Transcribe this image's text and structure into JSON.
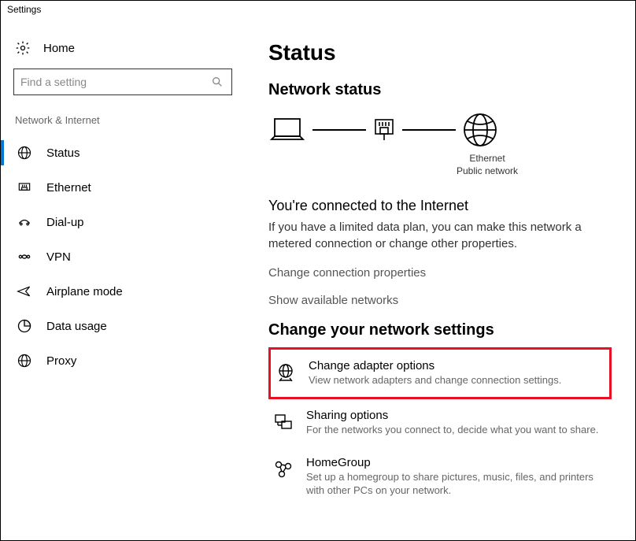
{
  "window_title": "Settings",
  "home_label": "Home",
  "search_placeholder": "Find a setting",
  "category_label": "Network & Internet",
  "nav": [
    {
      "label": "Status",
      "icon": "globe",
      "active": true
    },
    {
      "label": "Ethernet",
      "icon": "ethernet",
      "active": false
    },
    {
      "label": "Dial-up",
      "icon": "dialup",
      "active": false
    },
    {
      "label": "VPN",
      "icon": "vpn",
      "active": false
    },
    {
      "label": "Airplane mode",
      "icon": "airplane",
      "active": false
    },
    {
      "label": "Data usage",
      "icon": "datausage",
      "active": false
    },
    {
      "label": "Proxy",
      "icon": "proxy",
      "active": false
    }
  ],
  "page_title": "Status",
  "network_status_heading": "Network status",
  "diagram_label1": "Ethernet",
  "diagram_label2": "Public network",
  "connected_heading": "You're connected to the Internet",
  "connected_body": "If you have a limited data plan, you can make this network a metered connection or change other properties.",
  "link_change_props": "Change connection properties",
  "link_show_networks": "Show available networks",
  "change_settings_heading": "Change your network settings",
  "options": [
    {
      "title": "Change adapter options",
      "desc": "View network adapters and change connection settings.",
      "icon": "adapter",
      "highlight": true
    },
    {
      "title": "Sharing options",
      "desc": "For the networks you connect to, decide what you want to share.",
      "icon": "sharing",
      "highlight": false
    },
    {
      "title": "HomeGroup",
      "desc": "Set up a homegroup to share pictures, music, files, and printers with other PCs on your network.",
      "icon": "homegroup",
      "highlight": false
    }
  ]
}
